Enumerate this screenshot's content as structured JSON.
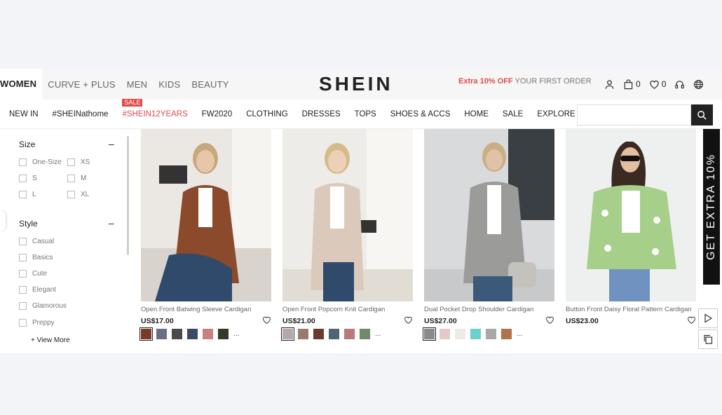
{
  "category_tabs": [
    "WOMEN",
    "CURVE + PLUS",
    "MEN",
    "KIDS",
    "BEAUTY"
  ],
  "logo": "SHEIN",
  "promo": {
    "highlight": "Extra 10% OFF",
    "rest": " YOUR FIRST ORDER"
  },
  "header_counts": {
    "bag": "0",
    "wishlist": "0"
  },
  "nav": {
    "sale_badge": "SALE",
    "items": [
      "NEW IN",
      "#SHEINathome",
      "#SHEIN12YEARS",
      "FW2020",
      "CLOTHING",
      "DRESSES",
      "TOPS",
      "SHOES & ACCS",
      "HOME",
      "SALE",
      "EXPLORE"
    ]
  },
  "search": {
    "placeholder": ""
  },
  "filters": {
    "size": {
      "title": "Size",
      "toggle": "–",
      "options": [
        "One-Size",
        "XS",
        "S",
        "M",
        "L",
        "XL"
      ]
    },
    "style": {
      "title": "Style",
      "toggle": "–",
      "options": [
        "Casual",
        "Basics",
        "Cute",
        "Elegant",
        "Glamorous",
        "Preppy"
      ]
    },
    "view_more": "+ View More"
  },
  "products": [
    {
      "title": "Open Front Batwing Sleeve Cardigan",
      "price": "US$17.00",
      "bg": "#e9e6e2",
      "garment": "#8a4a2b",
      "swatches": [
        "#7a3b26",
        "#6b7080",
        "#4a4a4a",
        "#3b4a66",
        "#c98080",
        "#333a2a"
      ]
    },
    {
      "title": "Open Front Popcorn Knit Cardigan",
      "price": "US$21.00",
      "bg": "#ecebe8",
      "garment": "#d9c8bb",
      "swatches": [
        "#b5a8a8",
        "#9a7a6a",
        "#6b3a2e",
        "#4f6577",
        "#b87a7a",
        "#6e8a6a"
      ]
    },
    {
      "title": "Dual Pocket Drop Shoulder Cardigan",
      "price": "US$27.00",
      "bg": "#d9dadc",
      "garment": "#9a9a98",
      "swatches": [
        "#8a8a8a",
        "#e8c8c4",
        "#ecebe4",
        "#6ccfd0",
        "#a8a8a8",
        "#b0734a"
      ]
    },
    {
      "title": "Button Front Daisy Floral Pattern Cardigan",
      "price": "US$23.00",
      "bg": "#e4e6e6",
      "garment": "#a6cf8a",
      "swatches": []
    }
  ],
  "swatch_more": "...",
  "side_banner": "GET EXTRA 10%"
}
